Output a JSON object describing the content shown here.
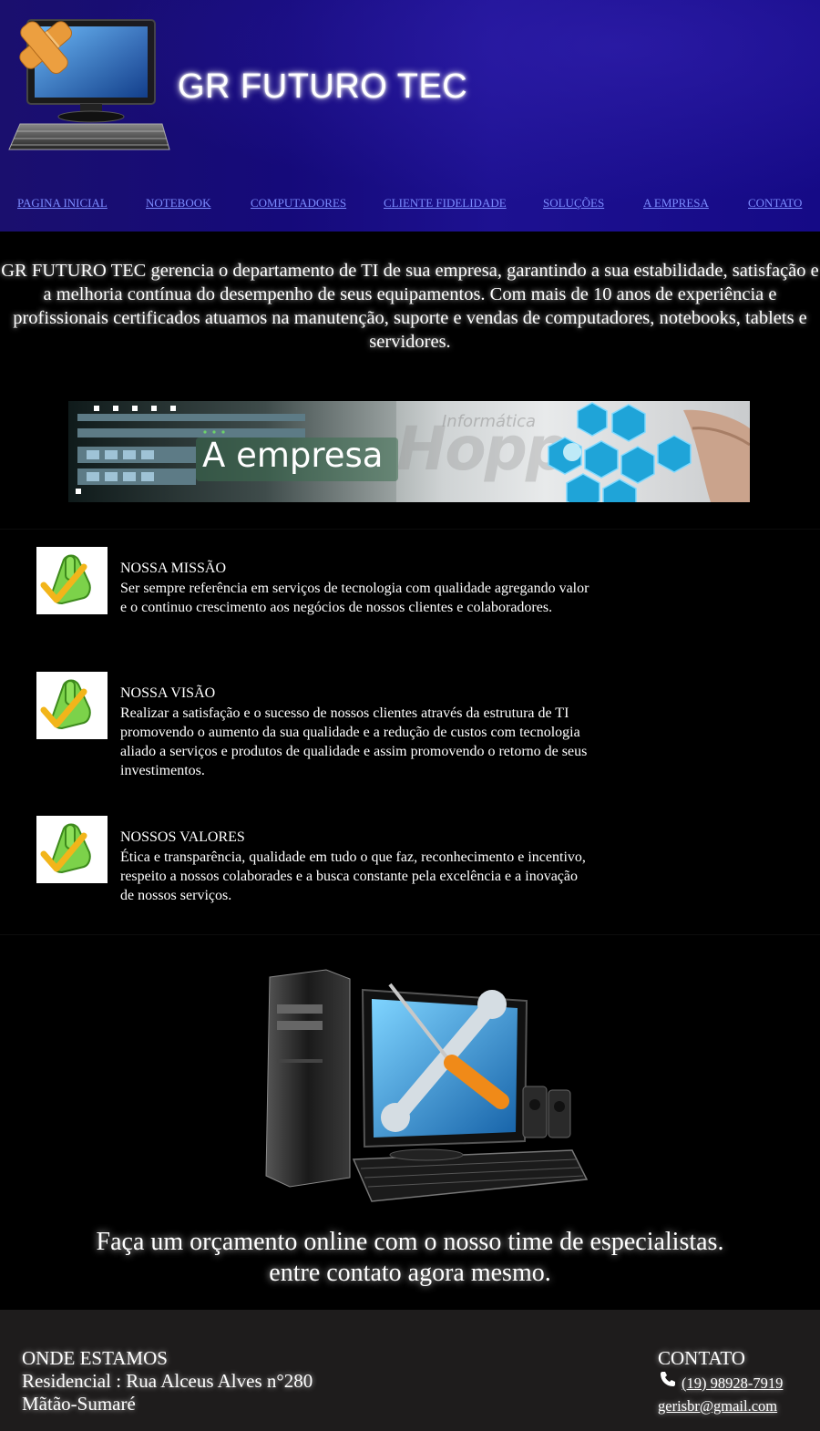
{
  "header": {
    "title": "GR FUTURO TEC",
    "nav": [
      {
        "label": "PAGINA INICIAL"
      },
      {
        "label": "NOTEBOOK"
      },
      {
        "label": "COMPUTADORES"
      },
      {
        "label": "CLIENTE FIDELIDADE"
      },
      {
        "label": "SOLUÇÕES"
      },
      {
        "label": "A EMPRESA"
      },
      {
        "label": "CONTATO"
      }
    ]
  },
  "intro": {
    "text": "GR FUTURO TEC gerencia o departamento de TI de sua empresa, garantindo a sua estabilidade, satisfação e a melhoria contínua do desempenho de seus equipamentos. Com mais de 10 anos de experiência e profissionais certificados atuamos na manutenção, suporte e vendas de computadores, notebooks, tablets e servidores."
  },
  "banner": {
    "label": "A empresa",
    "watermark": "Hopp",
    "watermark_sub": "Informática"
  },
  "features": [
    {
      "title": "NOSSA MISSÃO",
      "text": "Ser sempre referência em serviços de tecnologia com qualidade agregando valor e o continuo crescimento aos negócios de nossos clientes e colaboradores."
    },
    {
      "title": "NOSSA VISÃO",
      "text": "Realizar a satisfação e o sucesso de nossos clientes através da estrutura de TI promovendo o aumento da sua qualidade e a redução de custos com tecnologia aliado a serviços e produtos de qualidade e assim promovendo o retorno de seus investimentos."
    },
    {
      "title": "NOSSOS VALORES",
      "text": "Ética e transparência, qualidade em tudo o que faz, reconhecimento e incentivo, respeito a nossos colaborades e a busca constante pela excelência e a inovação de nossos serviços."
    }
  ],
  "cta": {
    "line1": "Faça um orçamento online com o nosso time de especialistas.",
    "line2": "entre contato agora mesmo."
  },
  "footer": {
    "location_title": "ONDE ESTAMOS",
    "address": "Residencial : Rua Alceus Alves n°280",
    "city": "Mãtão-Sumaré",
    "contact_title": "CONTATO",
    "phone": "(19) 98928-7919",
    "email": "gerisbr@gmail.com"
  },
  "colors": {
    "header_bg": "#150a7a",
    "nav_link": "#7c8cff",
    "footer_bg": "#1e1c1c",
    "page_bg": "#000000"
  },
  "icons": [
    "computer-logo-icon",
    "check-hand-icon",
    "phone-icon",
    "pc-repair-image"
  ]
}
